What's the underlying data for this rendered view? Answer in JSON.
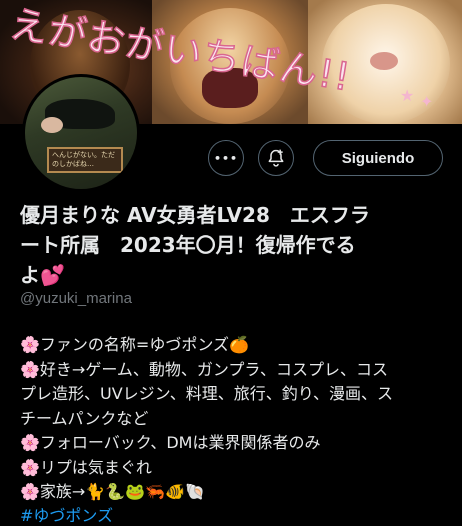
{
  "banner": {
    "text": "えがおがいちばん!!"
  },
  "profile": {
    "avatar_sign": "へんじがない。ただのしかばね…",
    "name_line1": "優月まりな AV女勇者LV28　エスフラ",
    "name_line2": "ート所属　2023年〇月！復帰作でる",
    "name_line3": "よ",
    "name_emoji": "💕",
    "handle": "@yuzuki_marina"
  },
  "actions": {
    "more_label": "•••",
    "notify_icon": "bell-plus-icon",
    "follow_label": "Siguiendo"
  },
  "bio": {
    "bullet": "🌸",
    "lines": [
      "ファンの名称=ゆづポンズ🍊",
      "好き→ゲーム、動物、ガンプラ、コスプレ、コス",
      "プレ造形、UVレジン、料理、旅行、釣り、漫画、ス",
      "チームパンクなど",
      "フォローバック、DMは業界関係者のみ",
      "リプは気まぐれ",
      "家族→🐈🐍🐸🦐🐠🐚"
    ],
    "hashtag_partial": "#ゆづポンズ"
  },
  "colors": {
    "background": "#000000",
    "text": "#e7e9ea",
    "muted": "#71767b",
    "border": "#536471",
    "link": "#1d9bf0"
  }
}
